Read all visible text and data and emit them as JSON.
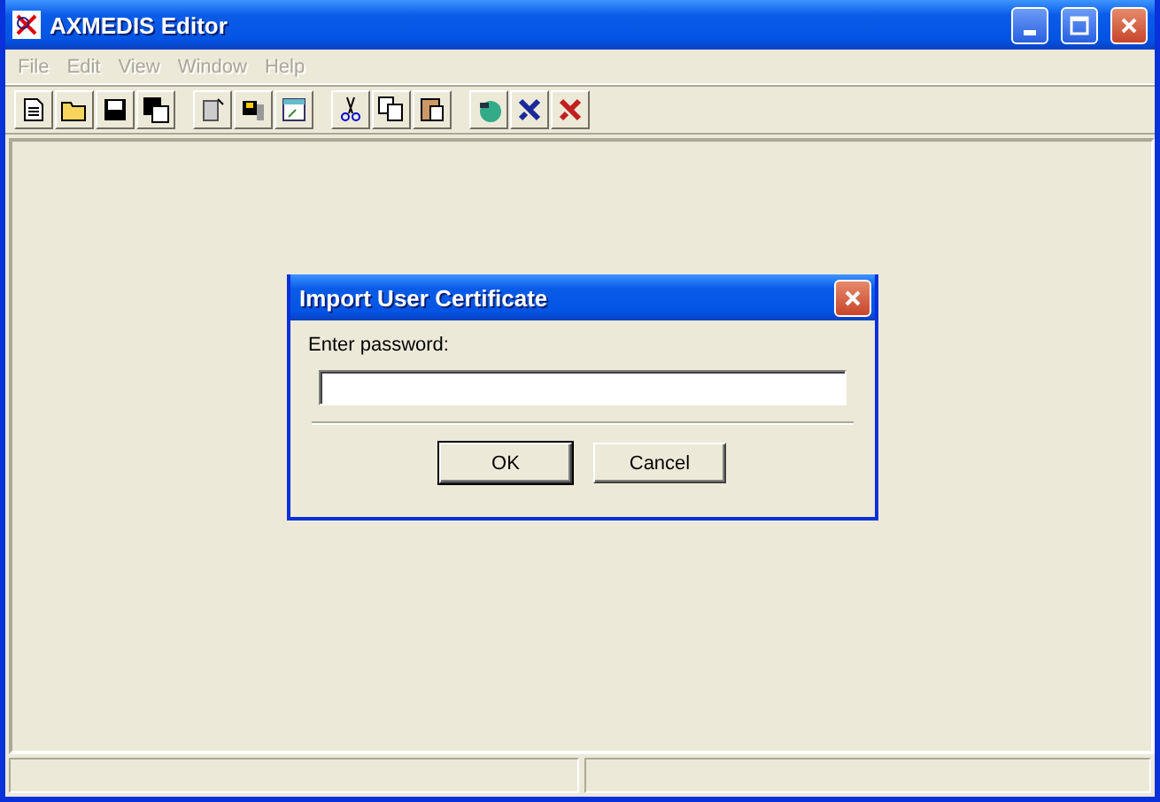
{
  "window": {
    "title": "AXMEDIS Editor"
  },
  "menu": [
    {
      "label": "File",
      "disabled": true
    },
    {
      "label": "Edit",
      "disabled": true
    },
    {
      "label": "View",
      "disabled": true
    },
    {
      "label": "Window",
      "disabled": true
    },
    {
      "label": "Help",
      "disabled": true
    }
  ],
  "dialog": {
    "title": "Import User Certificate",
    "label": "Enter password:",
    "buttons": [
      {
        "label": "OK",
        "default": true
      },
      {
        "label": "Cancel",
        "default": false
      }
    ]
  }
}
